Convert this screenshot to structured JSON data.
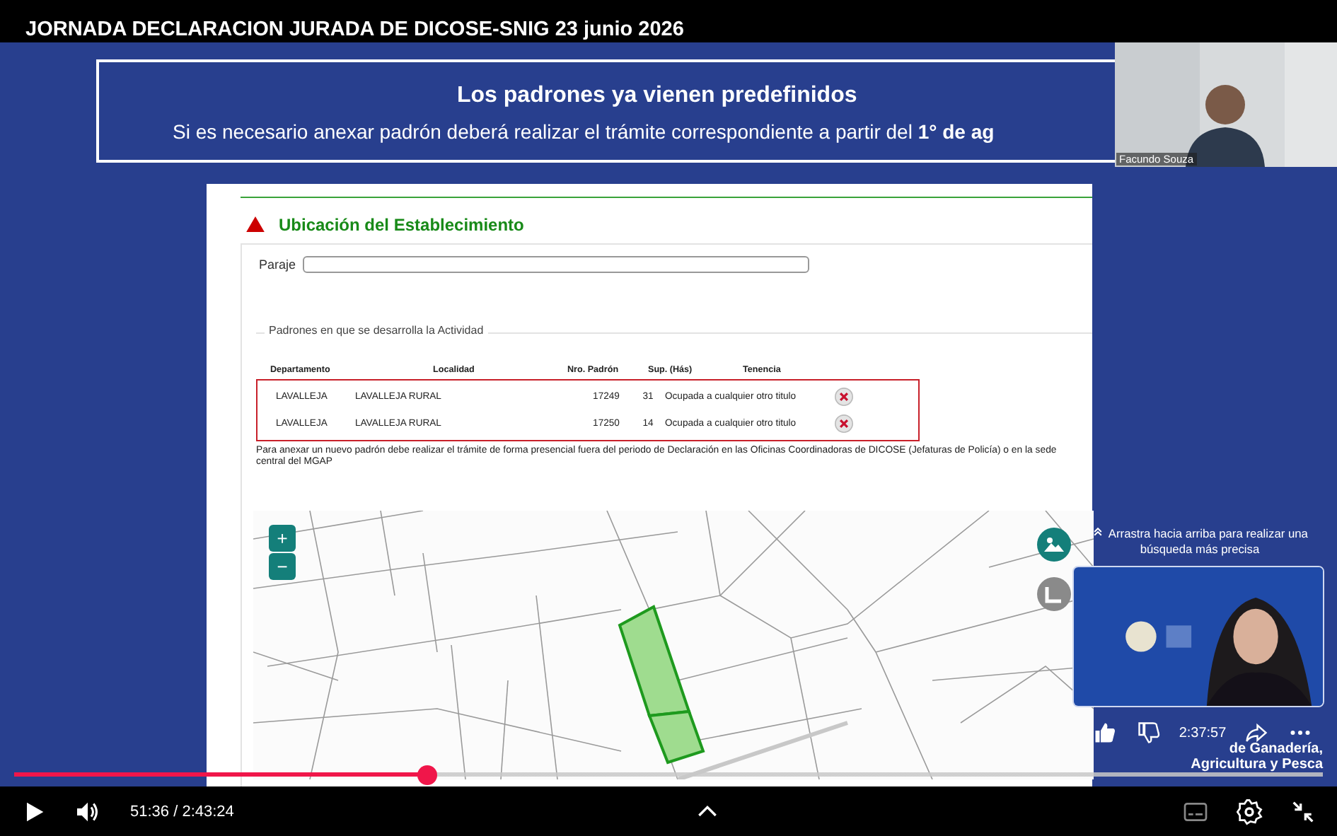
{
  "video_title": "JORNADA DECLARACION JURADA DE DICOSE-SNIG 23 junio 2026",
  "slide": {
    "heading": "Los padrones ya vienen predefinidos",
    "subheading": "Si es necesario anexar padrón deberá realizar el trámite correspondiente a partir del **1° de ag**"
  },
  "form": {
    "section_title": "Ubicación del Establecimiento",
    "paraje_label": "Paraje",
    "legend": "Padrones en que se desarrolla la Actividad",
    "columns": [
      "Departamento",
      "Localidad",
      "Nro. Padrón",
      "Sup. (Hás)",
      "Tenencia"
    ],
    "rows": [
      {
        "departamento": "LAVALLEJA",
        "localidad": "LAVALLEJA RURAL",
        "padron": "17249",
        "superficie": "31",
        "tenencia": "Ocupada a cualquier otro titulo"
      },
      {
        "departamento": "LAVALLEJA",
        "localidad": "LAVALLEJA RURAL",
        "padron": "17250",
        "superficie": "14",
        "tenencia": "Ocupada a cualquier otro titulo"
      }
    ],
    "note": "Para anexar un nuevo padrón debe realizar el trámite de forma presencial fuera del periodo de Declaración en las Oficinas Coordinadoras de DICOSE (Jefaturas de Policía) o en la sede central del MGAP",
    "map": {
      "zoom_in": "+",
      "zoom_out": "−"
    }
  },
  "speaker": {
    "name": "Facundo Souza"
  },
  "search_hint": "Arrastra hacia arriba para realizar una búsqueda más precisa",
  "actions": {
    "time": "2:37:57"
  },
  "ministry": [
    "de Ganadería,",
    "Agricultura y Pesca"
  ],
  "player": {
    "progress": {
      "level": 0.316
    },
    "time": "51:36 / 2:43:24"
  }
}
